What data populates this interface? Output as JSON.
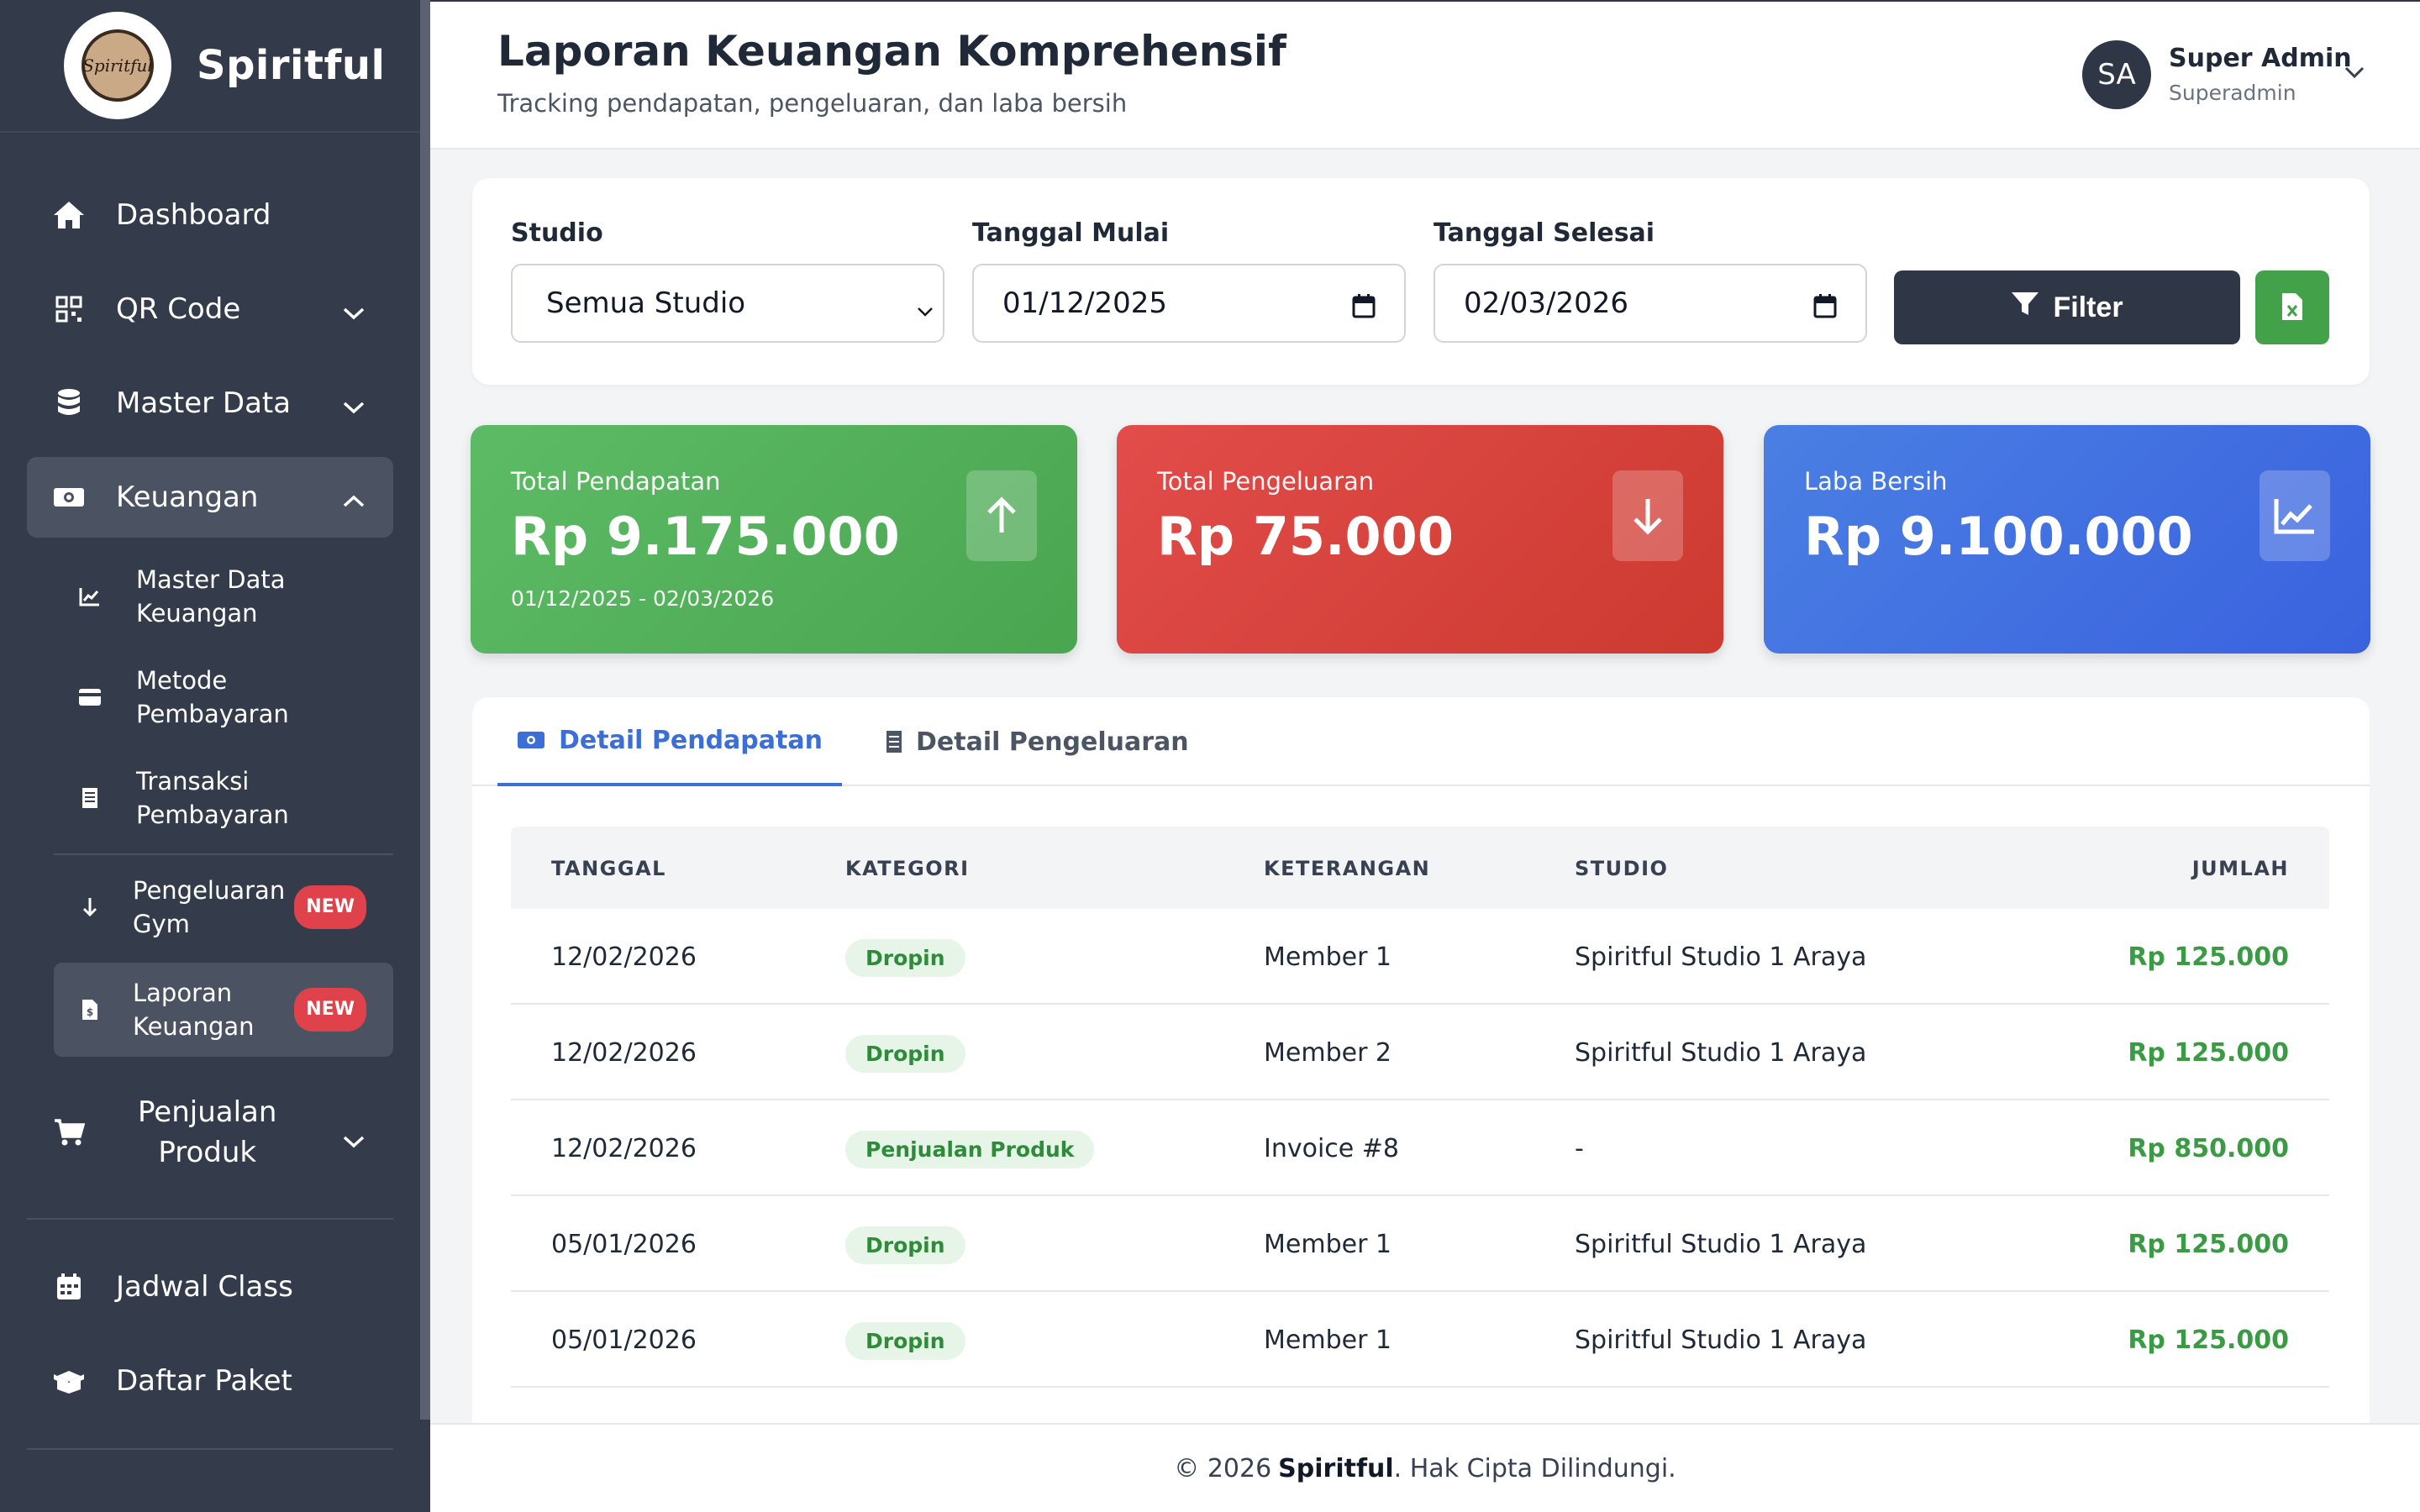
{
  "brand": {
    "name": "Spiritful",
    "logo_text": "Spiritful"
  },
  "sidebar": {
    "dashboard": "Dashboard",
    "qr_code": "QR Code",
    "master_data": "Master Data",
    "keuangan": "Keuangan",
    "sub": {
      "master_data_keuangan": [
        "Master Data",
        "Keuangan"
      ],
      "metode_pembayaran": [
        "Metode",
        "Pembayaran"
      ],
      "transaksi_pembayaran": [
        "Transaksi",
        "Pembayaran"
      ],
      "pengeluaran_gym": [
        "Pengeluaran",
        "Gym"
      ],
      "laporan_keuangan": [
        "Laporan",
        "Keuangan"
      ]
    },
    "badge_new": "NEW",
    "penjualan_produk": [
      "Penjualan",
      "Produk"
    ],
    "jadwal_class": "Jadwal Class",
    "daftar_paket": "Daftar Paket"
  },
  "header": {
    "title": "Laporan Keuangan Komprehensif",
    "subtitle": "Tracking pendapatan, pengeluaran, dan laba bersih",
    "avatar_initials": "SA",
    "user_name": "Super Admin",
    "user_role": "Superadmin"
  },
  "filter": {
    "studio_label": "Studio",
    "studio_value": "Semua Studio",
    "start_label": "Tanggal Mulai",
    "start_value": "01/12/2025",
    "end_label": "Tanggal Selesai",
    "end_value": "02/03/2026",
    "filter_button": "Filter"
  },
  "stats": {
    "pendapatan": {
      "label": "Total Pendapatan",
      "value": "Rp 9.175.000",
      "range": "01/12/2025 - 02/03/2026"
    },
    "pengeluaran": {
      "label": "Total Pengeluaran",
      "value": "Rp 75.000"
    },
    "laba": {
      "label": "Laba Bersih",
      "value": "Rp 9.100.000"
    }
  },
  "tabs": {
    "pendapatan": "Detail Pendapatan",
    "pengeluaran": "Detail Pengeluaran"
  },
  "table": {
    "headers": [
      "TANGGAL",
      "KATEGORI",
      "KETERANGAN",
      "STUDIO",
      "JUMLAH"
    ],
    "rows": [
      {
        "tanggal": "12/02/2026",
        "kategori": "Dropin",
        "keterangan": "Member 1",
        "studio": "Spiritful Studio 1 Araya",
        "jumlah": "Rp 125.000"
      },
      {
        "tanggal": "12/02/2026",
        "kategori": "Dropin",
        "keterangan": "Member 2",
        "studio": "Spiritful Studio 1 Araya",
        "jumlah": "Rp 125.000"
      },
      {
        "tanggal": "12/02/2026",
        "kategori": "Penjualan Produk",
        "keterangan": "Invoice #8",
        "studio": "-",
        "jumlah": "Rp 850.000"
      },
      {
        "tanggal": "05/01/2026",
        "kategori": "Dropin",
        "keterangan": "Member 1",
        "studio": "Spiritful Studio 1 Araya",
        "jumlah": "Rp 125.000"
      },
      {
        "tanggal": "05/01/2026",
        "kategori": "Dropin",
        "keterangan": "Member 1",
        "studio": "Spiritful Studio 1 Araya",
        "jumlah": "Rp 125.000"
      }
    ]
  },
  "footer": {
    "copyright": "© 2026",
    "brand": "Spiritful",
    "rights": ". Hak Cipta Dilindungi."
  },
  "colors": {
    "sidebar": "#343c4c",
    "green": "#4aa54f",
    "red": "#cc3a30",
    "blue": "#3a62df",
    "accent": "#3b6fd6"
  }
}
